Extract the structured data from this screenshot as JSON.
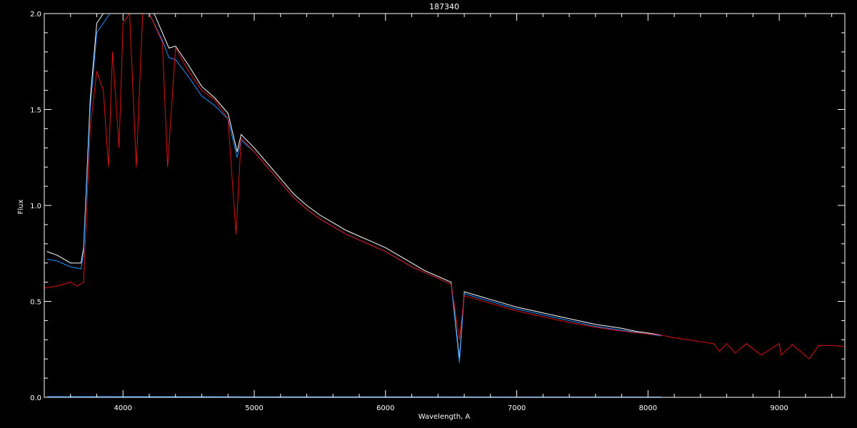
{
  "chart_data": {
    "type": "line",
    "title": "187340",
    "xlabel": "Wavelength, A",
    "ylabel": "Flux",
    "xlim": [
      3400,
      9500
    ],
    "ylim": [
      0.0,
      2.0
    ],
    "x_ticks": [
      4000,
      5000,
      6000,
      7000,
      8000,
      9000
    ],
    "y_ticks": [
      0.0,
      0.5,
      1.0,
      1.5,
      2.0
    ],
    "x_tick_labels": [
      "4000",
      "5000",
      "6000",
      "7000",
      "8000",
      "9000"
    ],
    "y_tick_labels": [
      "0.0",
      "0.5",
      "1.0",
      "1.5",
      "2.0"
    ],
    "grid": false,
    "colors": {
      "background": "#000000",
      "axes": "#ffffff",
      "observed": "#ffffff",
      "observed_blue": "#1e90ff",
      "model": "#dd1111",
      "error": "#1e90ff"
    },
    "series": [
      {
        "color": "#ffffff",
        "x": [
          3420,
          3500,
          3600,
          3680,
          3700,
          3750,
          3800,
          3900,
          4000,
          4100,
          4200,
          4250,
          4300,
          4350,
          4400,
          4500,
          4600,
          4700,
          4800,
          4870,
          4900,
          5000,
          5100,
          5200,
          5300,
          5400,
          5500,
          5600,
          5700,
          5800,
          5900,
          6000,
          6100,
          6200,
          6300,
          6400,
          6500,
          6563,
          6600,
          6700,
          6800,
          6900,
          7000,
          7100,
          7200,
          7300,
          7400,
          7500,
          7600,
          7700,
          7800,
          7900,
          8000,
          8100
        ],
        "y": [
          0.76,
          0.74,
          0.7,
          0.7,
          0.78,
          1.55,
          1.95,
          2.05,
          2.1,
          2.1,
          2.05,
          1.98,
          1.9,
          1.82,
          1.83,
          1.73,
          1.62,
          1.56,
          1.48,
          1.28,
          1.37,
          1.3,
          1.22,
          1.14,
          1.06,
          1.0,
          0.95,
          0.91,
          0.87,
          0.84,
          0.81,
          0.78,
          0.74,
          0.7,
          0.66,
          0.63,
          0.6,
          0.2,
          0.55,
          0.53,
          0.51,
          0.49,
          0.47,
          0.455,
          0.44,
          0.425,
          0.41,
          0.395,
          0.38,
          0.37,
          0.36,
          0.345,
          0.335,
          0.325
        ]
      },
      {
        "color": "#1e90ff",
        "x": [
          3420,
          3500,
          3600,
          3680,
          3700,
          3750,
          3800,
          3900,
          4000,
          4100,
          4200,
          4250,
          4300,
          4350,
          4400,
          4500,
          4600,
          4700,
          4800,
          4870,
          4900,
          5000,
          5100,
          5200,
          5300,
          5400,
          5500,
          5600,
          5700,
          5800,
          5900,
          6000,
          6100,
          6200,
          6300,
          6400,
          6500,
          6563,
          6600,
          6700,
          6800,
          6900,
          7000,
          7100,
          7200,
          7300,
          7400,
          7500,
          7600,
          7700,
          7800,
          7900,
          8000,
          8100
        ],
        "y": [
          0.72,
          0.71,
          0.68,
          0.67,
          0.75,
          1.5,
          1.9,
          2.0,
          2.05,
          2.05,
          2.0,
          1.93,
          1.86,
          1.77,
          1.76,
          1.67,
          1.57,
          1.52,
          1.45,
          1.25,
          1.34,
          1.28,
          1.2,
          1.12,
          1.04,
          0.98,
          0.93,
          0.89,
          0.85,
          0.82,
          0.79,
          0.76,
          0.72,
          0.68,
          0.65,
          0.62,
          0.59,
          0.18,
          0.54,
          0.52,
          0.5,
          0.48,
          0.46,
          0.445,
          0.43,
          0.415,
          0.4,
          0.385,
          0.37,
          0.36,
          0.35,
          0.34,
          0.33,
          0.32
        ]
      },
      {
        "color": "#dd1111",
        "x": [
          3400,
          3500,
          3600,
          3650,
          3700,
          3750,
          3800,
          3850,
          3889,
          3920,
          3970,
          4000,
          4050,
          4101,
          4150,
          4200,
          4300,
          4340,
          4400,
          4500,
          4600,
          4700,
          4800,
          4861,
          4900,
          5000,
          5100,
          5200,
          5300,
          5400,
          5500,
          5600,
          5700,
          5800,
          5900,
          6000,
          6100,
          6200,
          6300,
          6400,
          6500,
          6563,
          6600,
          6700,
          6800,
          6900,
          7000,
          7200,
          7400,
          7600,
          7800,
          8000,
          8100,
          8200,
          8300,
          8400,
          8500,
          8545,
          8600,
          8665,
          8750,
          8863,
          9000,
          9015,
          9100,
          9229,
          9300,
          9400,
          9500
        ],
        "y": [
          0.57,
          0.58,
          0.6,
          0.58,
          0.6,
          1.4,
          1.7,
          1.6,
          1.2,
          1.8,
          1.3,
          1.95,
          2.0,
          1.2,
          2.0,
          2.0,
          1.85,
          1.2,
          1.82,
          1.7,
          1.6,
          1.55,
          1.45,
          0.85,
          1.35,
          1.28,
          1.2,
          1.12,
          1.04,
          0.98,
          0.93,
          0.89,
          0.85,
          0.82,
          0.79,
          0.76,
          0.72,
          0.68,
          0.65,
          0.62,
          0.59,
          0.3,
          0.53,
          0.51,
          0.49,
          0.47,
          0.45,
          0.42,
          0.39,
          0.365,
          0.345,
          0.33,
          0.325,
          0.31,
          0.3,
          0.29,
          0.28,
          0.24,
          0.28,
          0.23,
          0.28,
          0.22,
          0.28,
          0.22,
          0.275,
          0.2,
          0.27,
          0.27,
          0.265
        ]
      },
      {
        "color": "#1e90ff",
        "x": [
          3420,
          4000,
          5000,
          6000,
          7000,
          8000,
          8100
        ],
        "y": [
          0.004,
          0.004,
          0.003,
          0.003,
          0.002,
          0.002,
          0.002
        ]
      }
    ]
  }
}
